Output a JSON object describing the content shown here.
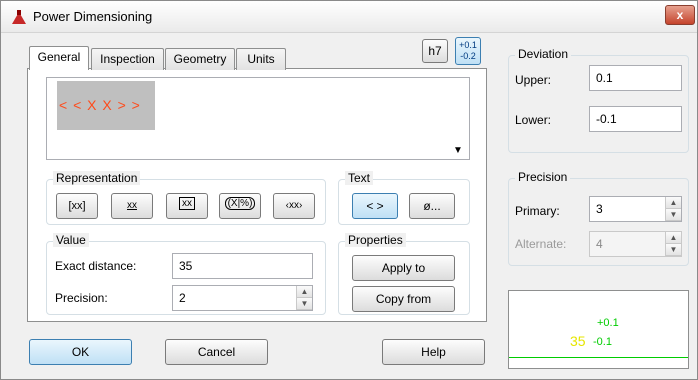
{
  "window": {
    "title": "Power Dimensioning",
    "close_glyph": "x",
    "icon": "app-icon"
  },
  "tabs": [
    {
      "label": "General",
      "active": true
    },
    {
      "label": "Inspection"
    },
    {
      "label": "Geometry"
    },
    {
      "label": "Units"
    }
  ],
  "toolbar": {
    "h7_label": "h7",
    "tol_top": "+0.1",
    "tol_bottom": "-0.2"
  },
  "preview_text": "< < X X > >",
  "representation": {
    "title": "Representation",
    "buttons": [
      "[xx]",
      "xx",
      "xx",
      "(X|%)",
      "‹xx›"
    ]
  },
  "text_group": {
    "title": "Text",
    "btn1": "< >",
    "btn2": "ø..."
  },
  "value_group": {
    "title": "Value",
    "exact_label": "Exact distance:",
    "exact_value": "35",
    "precision_label": "Precision:",
    "precision_value": "2"
  },
  "properties": {
    "title": "Properties",
    "apply": "Apply to",
    "copy": "Copy from"
  },
  "deviation": {
    "title": "Deviation",
    "upper_label": "Upper:",
    "upper_value": "0.1",
    "lower_label": "Lower:",
    "lower_value": "-0.1"
  },
  "precision_group": {
    "title": "Precision",
    "primary_label": "Primary:",
    "primary_value": "3",
    "alternate_label": "Alternate:",
    "alternate_value": "4"
  },
  "dim_preview": {
    "upper": "+0.1",
    "lower": "-0.1",
    "value": "35"
  },
  "buttons": {
    "ok": "OK",
    "cancel": "Cancel",
    "help": "Help"
  },
  "colors": {
    "accent": "#3c7fb1",
    "preview_red": "#ff4a1a",
    "preview_green": "#00cc00",
    "preview_yellow": "#e6e600"
  }
}
